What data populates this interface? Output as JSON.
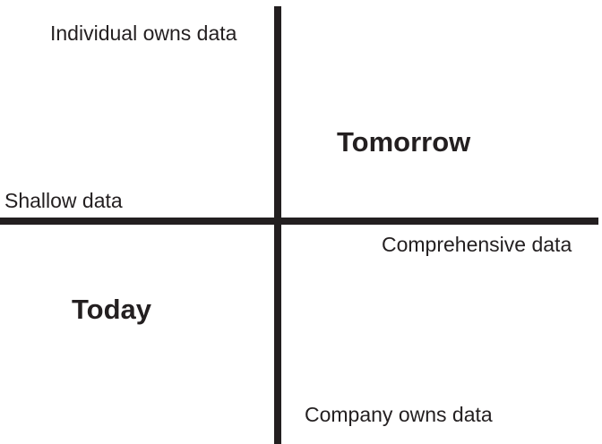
{
  "diagram": {
    "axes": {
      "vertical_top": "Individual owns data",
      "vertical_bottom": "Company owns data",
      "horizontal_left": "Shallow data",
      "horizontal_right": "Comprehensive data"
    },
    "quadrants": {
      "top_right": "Tomorrow",
      "bottom_left": "Today"
    },
    "colors": {
      "ink": "#231f20",
      "background": "#ffffff"
    }
  }
}
